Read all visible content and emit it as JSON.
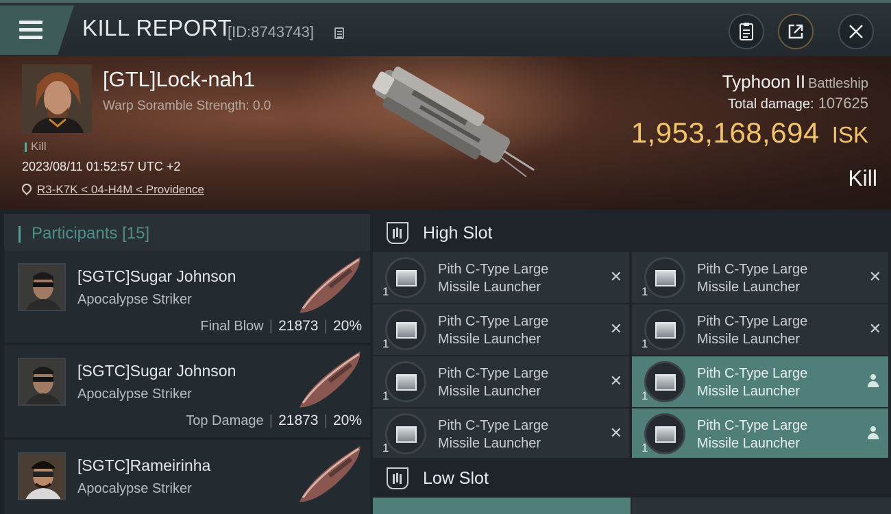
{
  "header": {
    "title": "KILL REPORT",
    "report_id": "[ID:8743743]"
  },
  "victim": {
    "name": "[GTL]Lock-nah1",
    "scramble": "Warp Soramble Strength: 0.0",
    "tag": "Kill",
    "datetime": "2023/08/11 01:52:57 UTC +2",
    "location": "R3-K7K < 04-H4M < Providence",
    "ship_name": "Typhoon II",
    "ship_class": "Battleship",
    "damage_label": "Total damage:",
    "damage_value": "107625",
    "isk_value": "1,953,168,694",
    "isk_unit": "ISK",
    "result": "Kill"
  },
  "participants": {
    "title": "Participants",
    "count": "[15]",
    "rows": [
      {
        "name": "[SGTC]Sugar Johnson",
        "ship": "Apocalypse Striker",
        "label": "Final Blow",
        "damage": "21873",
        "percent": "20%"
      },
      {
        "name": "[SGTC]Sugar Johnson",
        "ship": "Apocalypse Striker",
        "label": "Top Damage",
        "damage": "21873",
        "percent": "20%"
      },
      {
        "name": "[SGTC]Rameirinha",
        "ship": "Apocalypse Striker",
        "label": "",
        "damage": "",
        "percent": ""
      }
    ]
  },
  "fitting": {
    "high_slot_title": "High Slot",
    "low_slot_title": "Low Slot",
    "high_modules": [
      {
        "name": "Pith C-Type Large\nMissile Launcher",
        "qty": "1",
        "state": "destroyed"
      },
      {
        "name": "Pith C-Type Large\nMissile Launcher",
        "qty": "1",
        "state": "destroyed"
      },
      {
        "name": "Pith C-Type Large\nMissile Launcher",
        "qty": "1",
        "state": "destroyed"
      },
      {
        "name": "Pith C-Type Large\nMissile Launcher",
        "qty": "1",
        "state": "destroyed"
      },
      {
        "name": "Pith C-Type Large\nMissile Launcher",
        "qty": "1",
        "state": "destroyed"
      },
      {
        "name": "Pith C-Type Large\nMissile Launcher",
        "qty": "1",
        "state": "dropped"
      },
      {
        "name": "Pith C-Type Large\nMissile Launcher",
        "qty": "1",
        "state": "destroyed"
      },
      {
        "name": "Pith C-Type Large\nMissile Launcher",
        "qty": "1",
        "state": "dropped"
      }
    ]
  },
  "icons": {
    "menu": "hamburger-icon",
    "copy": "copy-icon",
    "clipboard": "clipboard-icon",
    "share": "share-icon",
    "close": "close-icon",
    "pin": "map-pin-icon",
    "destroyed": "x-icon",
    "dropped": "person-icon"
  },
  "colors": {
    "accent": "#4aa59a",
    "isk": "#f2c46a",
    "active_module": "#4f7f78"
  }
}
